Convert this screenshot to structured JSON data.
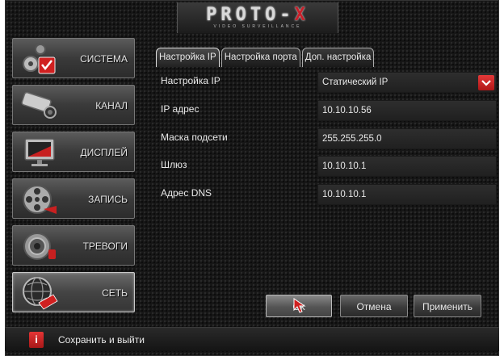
{
  "brand": {
    "logo_main": "PROTO",
    "logo_separator": "-",
    "logo_x": "X",
    "logo_sub": "VIDEO SURVEILLANCE"
  },
  "sidebar": {
    "items": [
      {
        "label": "СИСТЕМА",
        "icon": "system-gear-icon",
        "active": false
      },
      {
        "label": "КАНАЛ",
        "icon": "camera-icon",
        "active": false
      },
      {
        "label": "ДИСПЛЕЙ",
        "icon": "monitor-icon",
        "active": false
      },
      {
        "label": "ЗАПИСЬ",
        "icon": "film-reel-icon",
        "active": false
      },
      {
        "label": "ТРЕВОГИ",
        "icon": "alarm-icon",
        "active": false
      },
      {
        "label": "СЕТЬ",
        "icon": "globe-network-icon",
        "active": true
      }
    ]
  },
  "tabs": [
    {
      "label": "Настройка IP",
      "active": true
    },
    {
      "label": "Настройка порта",
      "active": false
    },
    {
      "label": "Доп. настройка",
      "active": false
    }
  ],
  "form": {
    "ip_mode": {
      "label": "Настройка IP",
      "value": "Статический IP"
    },
    "ip_address": {
      "label": "IP адрес",
      "value": "10.10.10.56"
    },
    "subnet_mask": {
      "label": "Маска подсети",
      "value": "255.255.255.0"
    },
    "gateway": {
      "label": "Шлюз",
      "value": "10.10.10.1"
    },
    "dns": {
      "label": "Адрес DNS",
      "value": "10.10.10.1"
    }
  },
  "buttons": {
    "ok": "Ok",
    "cancel": "Отмена",
    "apply": "Применить"
  },
  "status": {
    "icon_text": "i",
    "text": "Сохранить и выйти"
  },
  "colors": {
    "accent": "#c8202a",
    "background": "#161616"
  }
}
